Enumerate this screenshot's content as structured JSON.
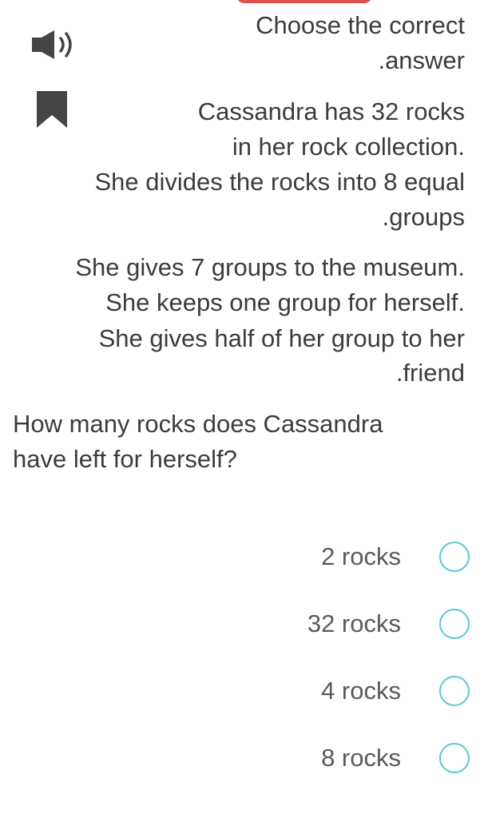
{
  "header": {
    "instruction_lines": [
      "Choose the correct",
      ".answer"
    ]
  },
  "icons": {
    "speaker": "speaker-volume-icon",
    "bookmark": "bookmark-icon"
  },
  "question": {
    "lines": [
      "Cassandra has 32 rocks",
      "in her rock collection.",
      "She divides the rocks into 8 equal",
      ".groups",
      "She gives 7 groups to the museum.",
      "She keeps one group for herself.",
      "She gives half of her group to her",
      ".friend"
    ],
    "prompt_lines": [
      "How many rocks does Cassandra",
      "have left for herself?"
    ]
  },
  "options": [
    {
      "label": "2 rocks",
      "selected": false
    },
    {
      "label": "32 rocks",
      "selected": false
    },
    {
      "label": "4 rocks",
      "selected": false
    },
    {
      "label": "8 rocks",
      "selected": false
    }
  ],
  "colors": {
    "accent_tab": "#e14e4e",
    "radio_border": "#5cc6d0",
    "text": "#3c3c3c",
    "icon": "#444444"
  }
}
